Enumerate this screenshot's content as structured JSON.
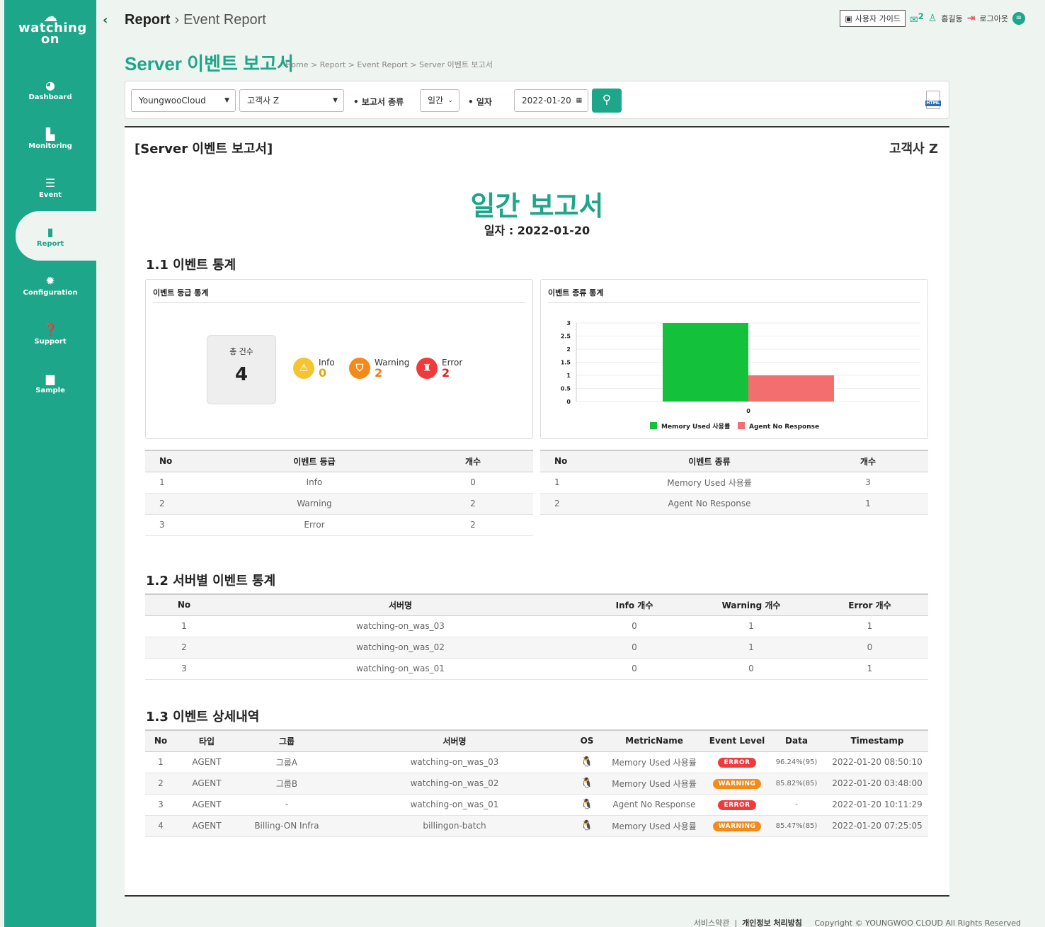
{
  "sidebar": {
    "logo_word": "watching on",
    "items": [
      {
        "label": "Dashboard",
        "icon": "dashboard-icon"
      },
      {
        "label": "Monitoring",
        "icon": "monitoring-icon"
      },
      {
        "label": "Event",
        "icon": "event-icon"
      },
      {
        "label": "Report",
        "icon": "report-icon"
      },
      {
        "label": "Configuration",
        "icon": "gear-icon"
      },
      {
        "label": "Support",
        "icon": "help-icon"
      },
      {
        "label": "Sample",
        "icon": "file-icon"
      }
    ]
  },
  "header": {
    "crumb_main": "Report",
    "crumb_sub": "Event Report",
    "guide": "사용자 가이드",
    "user": "홍길동",
    "logout": "로그아웃",
    "notify_count": "2"
  },
  "page": {
    "title": "Server 이벤트 보고서",
    "breadcrumb": "Home > Report > Event Report > Server 이벤트 보고서"
  },
  "filter": {
    "cloud": "YoungwooCloud",
    "customer": "고객사 Z",
    "report_type_label": "• 보고서 종류",
    "report_type": "일간",
    "date_label": "• 일자",
    "date": "2022-01-20"
  },
  "report": {
    "title": "[Server 이벤트 보고서]",
    "customer": "고객사 Z",
    "big_title": "일간 보고서",
    "date_line": "일자 : 2022-01-20",
    "sec1": "1.1 이벤트 통계",
    "grade_card_title": "이벤트 등급 통계",
    "type_card_title": "이벤트 종류 통계",
    "total_label": "총 건수",
    "total": "4",
    "levels": {
      "info_label": "Info",
      "info": "0",
      "warning_label": "Warning",
      "warning": "2",
      "error_label": "Error",
      "error": "2"
    },
    "grade_table": {
      "headers": [
        "No",
        "이벤트 등급",
        "개수"
      ],
      "rows": [
        [
          "1",
          "Info",
          "0"
        ],
        [
          "2",
          "Warning",
          "2"
        ],
        [
          "3",
          "Error",
          "2"
        ]
      ]
    },
    "type_table": {
      "headers": [
        "No",
        "이벤트 종류",
        "개수"
      ],
      "rows": [
        [
          "1",
          "Memory Used 사용률",
          "3"
        ],
        [
          "2",
          "Agent No Response",
          "1"
        ]
      ]
    },
    "sec2": "1.2 서버별 이벤트 통계",
    "server_table": {
      "headers": [
        "No",
        "서버명",
        "Info 개수",
        "Warning 개수",
        "Error 개수"
      ],
      "rows": [
        [
          "1",
          "watching-on_was_03",
          "0",
          "1",
          "1"
        ],
        [
          "2",
          "watching-on_was_02",
          "0",
          "1",
          "0"
        ],
        [
          "3",
          "watching-on_was_01",
          "0",
          "0",
          "1"
        ]
      ]
    },
    "sec3": "1.3 이벤트 상세내역",
    "detail_table": {
      "headers": [
        "No",
        "타입",
        "그룹",
        "서버명",
        "OS",
        "MetricName",
        "Event Level",
        "Data",
        "Timestamp"
      ],
      "rows": [
        [
          "1",
          "AGENT",
          "그룹A",
          "watching-on_was_03",
          "linux",
          "Memory Used 사용률",
          "ERROR",
          "96.24%(95)",
          "2022-01-20 08:50:10"
        ],
        [
          "2",
          "AGENT",
          "그룹B",
          "watching-on_was_02",
          "linux",
          "Memory Used 사용률",
          "WARNING",
          "85.82%(85)",
          "2022-01-20 03:48:00"
        ],
        [
          "3",
          "AGENT",
          "-",
          "watching-on_was_01",
          "linux",
          "Agent No Response",
          "ERROR",
          "-",
          "2022-01-20 10:11:29"
        ],
        [
          "4",
          "AGENT",
          "Billing-ON Infra",
          "billingon-batch",
          "linux",
          "Memory Used 사용률",
          "WARNING",
          "85.47%(85)",
          "2022-01-20 07:25:05"
        ]
      ]
    }
  },
  "chart_data": {
    "type": "bar",
    "categories": [
      "0"
    ],
    "series": [
      {
        "name": "Memory Used 사용률",
        "values": [
          3
        ],
        "color": "#14c13a"
      },
      {
        "name": "Agent No Response",
        "values": [
          1
        ],
        "color": "#f36f6f"
      }
    ],
    "yticks": [
      "0",
      "0.5",
      "1",
      "1.5",
      "2",
      "2.5",
      "3"
    ],
    "ylim": [
      0,
      3
    ],
    "legend": "bottom"
  },
  "colors": {
    "accent": "#1ea68a",
    "info": "#f5c433",
    "warning": "#f28b1a",
    "error": "#ef3b3b"
  },
  "footer": {
    "terms": "서비스약관",
    "privacy": "개인정보 처리방침",
    "copyright": "Copyright © YOUNGWOO CLOUD All Rights Reserved"
  }
}
